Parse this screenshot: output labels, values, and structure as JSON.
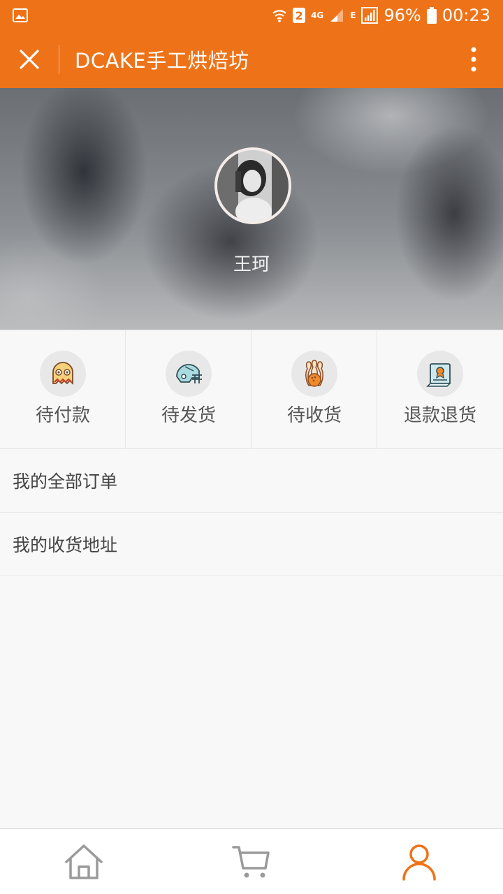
{
  "status_bar": {
    "sim_badge": "2",
    "network_4g": "4G",
    "network_e": "E",
    "battery": "96%",
    "time": "00:23"
  },
  "title_bar": {
    "title": "DCAKE手工烘焙坊"
  },
  "profile": {
    "username": "王珂"
  },
  "order_status": [
    {
      "label": "待付款",
      "icon": "ghost-icon"
    },
    {
      "label": "待发货",
      "icon": "helmet-icon"
    },
    {
      "label": "待收货",
      "icon": "bowling-icon"
    },
    {
      "label": "退款退货",
      "icon": "certificate-icon"
    }
  ],
  "menu": {
    "all_orders": "我的全部订单",
    "addresses": "我的收货地址"
  },
  "bottom_nav": [
    {
      "name": "home",
      "icon": "home-icon"
    },
    {
      "name": "cart",
      "icon": "cart-icon"
    },
    {
      "name": "profile",
      "icon": "user-icon",
      "active": true
    }
  ],
  "colors": {
    "accent": "#ee7318",
    "nav_inactive": "#9a9a9a",
    "background": "#f8f8f8"
  }
}
